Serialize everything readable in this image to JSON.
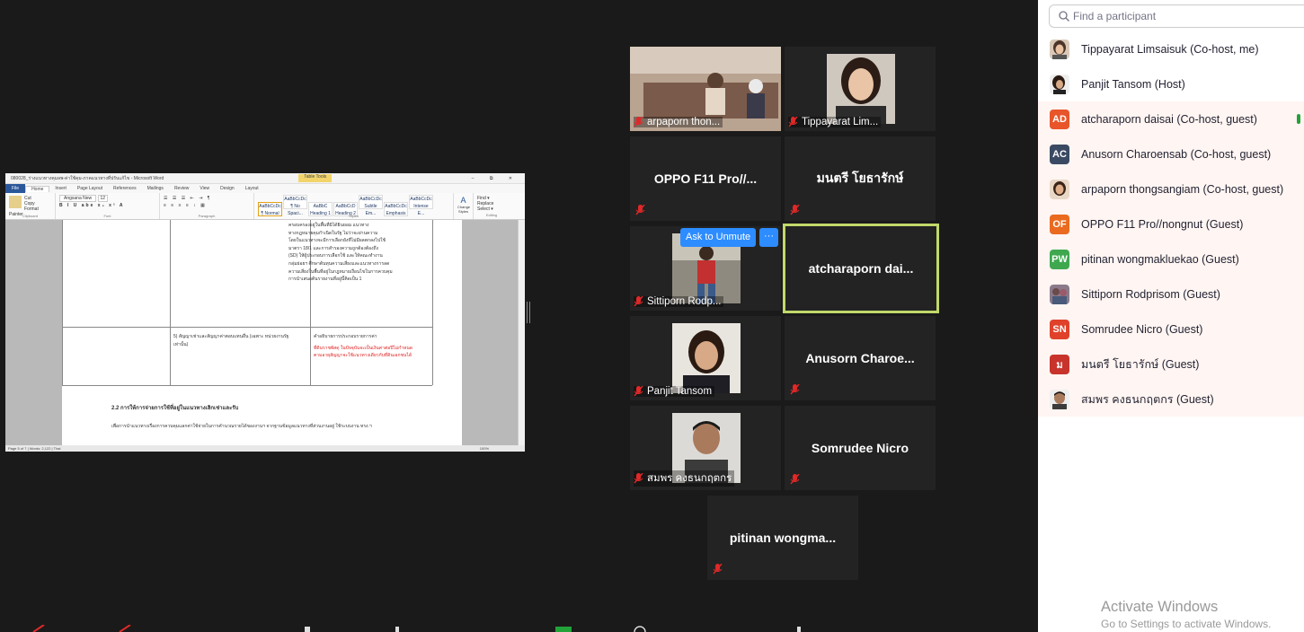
{
  "shared_screen": {
    "window_title": "080028_ร่างแนวทางคุมลพ-ค่าใช้คุม-ภาคแนวทางที่ปรับแก้ไข - Microsoft Word",
    "contextual_tab": "Table Tools",
    "window_controls": "–  ⧉  ✕",
    "tabs": [
      "File",
      "Home",
      "Insert",
      "Page Layout",
      "References",
      "Mailings",
      "Review",
      "View",
      "Design",
      "Layout"
    ],
    "font_name": "Angsana New",
    "font_size": "12",
    "ribbon_groups": [
      "Clipboard",
      "Font",
      "Paragraph",
      "Styles",
      "Editing"
    ],
    "clipboard_items": [
      "Cut",
      "Copy",
      "Format Painter"
    ],
    "paste_label": "Paste",
    "styles": [
      "¶ Normal",
      "¶ No Spaci...",
      "Heading 1",
      "Heading 2",
      "Subtle Em...",
      "Emphasis",
      "Intense E..."
    ],
    "editing_items": [
      "Find ▾",
      "Replace",
      "Select ▾"
    ],
    "change_styles": "Change Styles",
    "doc_lines_top": [
      "ครอบครองอยู่ในพื้นที่มิได้ยินยอม แนวทาง",
      "ทางกฎหมายคุมกำเนิดในรัฐ ไม่ว่าจะผ่านความ",
      "โดยในแนวทางจะมีการเลือกยังที่ไม่มีผลตกลงไปใช้",
      "มาตรา 18/1 และการสำรองความถูกต้องต้องถึง",
      "(SD) ให้ผู้ประกอบการเลือกใช้ และให้คณะทำงาน",
      "กลุ่มย่อยฯ ศึกษาต้นทุนความเสี่ยงและแนวทางการลด",
      "ความเสี่ยงในพื้นที่อยู่ในกฎหมายเงื่อนไขในการควบคุม",
      "การนำเสนอต้นรายงานที่อยู่นี้คิดเป็น 1"
    ],
    "doc_row2_left": [
      "5) สัญญาเช่าและสัญญาค่าตอบแทนอื่น (เฉพาะ หน่วยงานรัฐ",
      "เท่านั้น)"
    ],
    "doc_row2_right": [
      "คำอธิบายการประกอบรายการค่า"
    ],
    "doc_row2_red": [
      "ที่ดินราชพัสดุ ในปัจจุบันจะเป็นเงินค่าต่อปีไม่กำหนด",
      "ตามอายุสัญญาจะใช้แนวทางเดียวกับที่ดินเอกชนได้"
    ],
    "doc_heading": "2.2 การให้การจ่ายการใช้ที่อยู่ในแนวทางเลิกเช่าและรับ",
    "doc_para": "เพื่อการนำแนวทางเรื่องการควบคุมแลกค่าใช้จ่ายในการคำนวณรายได้ของงานฯ จากฐานข้อมูลแนวทางที่ส่วนงานอยู่ ใช้ระบบงาน ทรง.ฯ",
    "status_bar": "Page 5 of 7  |  Words: 2,122  |  Thai",
    "zoom": "100%"
  },
  "tiles": [
    {
      "id": "arpaporn",
      "display": "arpaporn thon...",
      "has_video": true
    },
    {
      "id": "tippayarat",
      "display": "Tippayarat Lim...",
      "has_video": true
    },
    {
      "id": "oppo",
      "display": "OPPO F11 Pro//...",
      "has_video": false
    },
    {
      "id": "monthri",
      "display": "มนตรี  โยธารักษ์",
      "has_video": false
    },
    {
      "id": "sittiporn",
      "display": "Sittiporn Rodp...",
      "has_video": true,
      "ask_unmute": "Ask to Unmute",
      "more": "···"
    },
    {
      "id": "atcharaporn",
      "display": "atcharaporn  dai...",
      "has_video": false,
      "active": true
    },
    {
      "id": "panjit",
      "display": "Panjit Tansom",
      "has_video": true
    },
    {
      "id": "anusorn",
      "display": "Anusorn  Charoe...",
      "has_video": false
    },
    {
      "id": "somporn",
      "display": "สมพร คงธนกฤตกร",
      "has_video": true
    },
    {
      "id": "somrudee",
      "display": "Somrudee Nicro",
      "has_video": false
    },
    {
      "id": "pitinan",
      "display": "pitinan  wongma...",
      "has_video": false
    }
  ],
  "participants_panel": {
    "search_placeholder": "Find a participant",
    "participants": [
      {
        "name": "Tippayarat Limsaisuk (Co-host, me)",
        "avatar": "photo",
        "color": "#7a6a5a"
      },
      {
        "name": "Panjit Tansom (Host)",
        "avatar": "photo",
        "color": "#5a4a3a"
      },
      {
        "name": "atcharaporn daisai (Co-host, guest)",
        "avatar": "AD",
        "color": "#e8552a",
        "highlight": true
      },
      {
        "name": "Anusorn Charoensab (Co-host, guest)",
        "avatar": "AC",
        "color": "#3b4a63",
        "highlight": true
      },
      {
        "name": "arpaporn thongsangiam (Co-host, guest)",
        "avatar": "photo",
        "color": "#a86a4a",
        "highlight": true
      },
      {
        "name": "OPPO F11 Pro//nongnut (Guest)",
        "avatar": "OF",
        "color": "#ea6a1f",
        "highlight": true
      },
      {
        "name": "pitinan wongmakluekao (Guest)",
        "avatar": "PW",
        "color": "#3fa84f",
        "highlight": true
      },
      {
        "name": "Sittiporn Rodprisom (Guest)",
        "avatar": "photo",
        "color": "#6a4a5a",
        "highlight": true
      },
      {
        "name": "Somrudee Nicro (Guest)",
        "avatar": "SN",
        "color": "#e0412a",
        "highlight": true
      },
      {
        "name": "มนตรี  โยธารักษ์ (Guest)",
        "avatar": "ม",
        "color": "#c8342c",
        "highlight": true
      },
      {
        "name": "สมพร คงธนกฤตกร (Guest)",
        "avatar": "photo",
        "color": "#4a5a6a",
        "highlight": true
      }
    ]
  },
  "watermark": {
    "line1": "Activate Windows",
    "line2": "Go to Settings to activate Windows."
  },
  "colors": {
    "background": "#1a1a1a",
    "tile": "#232323",
    "active_speaker_border": "#c1d96a",
    "ask_button": "#2d8cff",
    "muted_mic": "#e02828"
  }
}
